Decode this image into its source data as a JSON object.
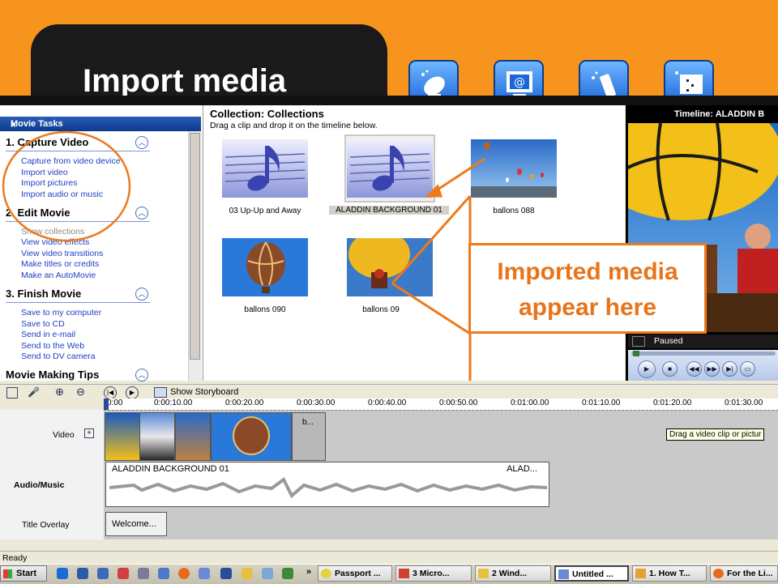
{
  "slide": {
    "title": "Import media"
  },
  "tasks": {
    "header": "Movie Tasks",
    "close": "×",
    "sections": [
      {
        "title": "1. Capture Video",
        "links": [
          "Capture from video device",
          "Import video",
          "Import pictures",
          "Import audio or music"
        ]
      },
      {
        "title": "2. Edit Movie",
        "links": [
          "Show collections",
          "View video effects",
          "View video transitions",
          "Make titles or credits",
          "Make an AutoMovie"
        ]
      },
      {
        "title": "3. Finish Movie",
        "links": [
          "Save to my computer",
          "Save to CD",
          "Send in e-mail",
          "Send to the Web",
          "Send to DV camera"
        ]
      },
      {
        "title": "Movie Making Tips",
        "links": []
      }
    ]
  },
  "collection": {
    "title": "Collection: Collections",
    "subtitle": "Drag a clip and drop it on the timeline below.",
    "items": [
      {
        "label": "03 Up-Up and Away",
        "kind": "music-note-icon"
      },
      {
        "label": "ALADDIN BACKGROUND 01",
        "kind": "music-note-icon",
        "selected": true
      },
      {
        "label": "ballons 088",
        "kind": "photo"
      },
      {
        "label": "ballons 090",
        "kind": "photo"
      },
      {
        "label": "ballons 09",
        "kind": "photo"
      }
    ]
  },
  "preview": {
    "title": "Timeline: ALADDIN B",
    "status": "Paused"
  },
  "callout": {
    "line1": "Imported media",
    "line2": "appear here"
  },
  "timeline": {
    "show_storyboard": "Show Storyboard",
    "ticks": [
      "0:00",
      "0:00:10.00",
      "0:00:20.00",
      "0:00:30.00",
      "0:00:40.00",
      "0:00:50.00",
      "0:01:00.00",
      "0:01:10.00",
      "0:01:20.00",
      "0:01:30.00"
    ],
    "tracks": {
      "video": "Video",
      "audio": "Audio/Music",
      "title": "Title Overlay"
    },
    "video_last_clip": "b...",
    "drag_tip": "Drag a video clip or pictur",
    "audio_clip_name": "ALADDIN BACKGROUND 01",
    "audio_clip_end": "ALAD...",
    "title_clip": "Welcome..."
  },
  "status": {
    "text": "Ready"
  },
  "taskbar": {
    "start": "Start",
    "more": "»",
    "buttons": [
      "Passport ...",
      "3 Micro...",
      "2 Wind...",
      "Untitled ...",
      "1. How T...",
      "For the Li..."
    ]
  },
  "colors": {
    "orange": "#f7941d",
    "callout_text": "#e8741a",
    "link_blue": "#1f3fc4"
  }
}
